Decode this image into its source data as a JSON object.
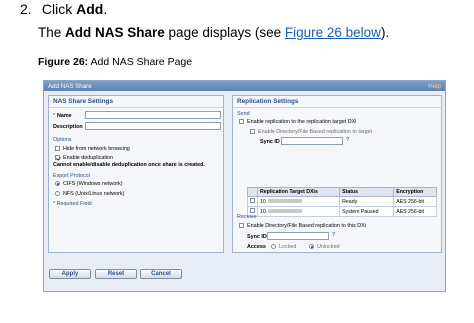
{
  "step": {
    "number": "2.",
    "text_prefix": "Click ",
    "text_bold": "Add",
    "text_suffix": "."
  },
  "description": {
    "prefix": "The ",
    "bold": "Add NAS Share",
    "middle": " page displays (see ",
    "link": "Figure 26 below",
    "suffix": ")."
  },
  "figure_caption": {
    "bold": "Figure 26:",
    "text": " Add NAS Share Page"
  },
  "dialog": {
    "title": "Add NAS Share",
    "help": "Help",
    "left_panel": {
      "title": "NAS Share Settings",
      "name_label": "Name",
      "description_label": "Description",
      "required_star": "*",
      "options_section": "Options",
      "hide_browsing": "Hide from network browsing",
      "enable_dedup": "Enable deduplication",
      "dedup_warning": "Cannot enable/disable deduplication once share is created.",
      "export_section": "Export Protocol",
      "cifs": "CIFS (Windows network)",
      "nfs": "NFS (Unix/Linux network)",
      "required_note": "* Required Field"
    },
    "right_panel": {
      "title": "Replication Settings",
      "send_section": "Send",
      "enable_replication": "Enable replication to the replication target DXi",
      "enable_dir_file": "Enable Directory/File Based replication to target",
      "sync_id_label": "Sync ID",
      "help_mark": "?",
      "table": {
        "headers": [
          "Replication Target DXis",
          "Status",
          "Encryption"
        ],
        "rows": [
          {
            "target": "10.",
            "status": "Ready",
            "encryption": "AES 256-bit"
          },
          {
            "target": "10.",
            "status": "System Paused",
            "encryption": "AES 256-bit"
          }
        ]
      },
      "receive_section": "Receive",
      "enable_receive": "Enable Directory/File Based replication to this DXi",
      "access_label": "Access",
      "locked": "Locked",
      "unlocked": "Unlocked"
    },
    "buttons": {
      "apply": "Apply",
      "reset": "Reset",
      "cancel": "Cancel"
    }
  }
}
